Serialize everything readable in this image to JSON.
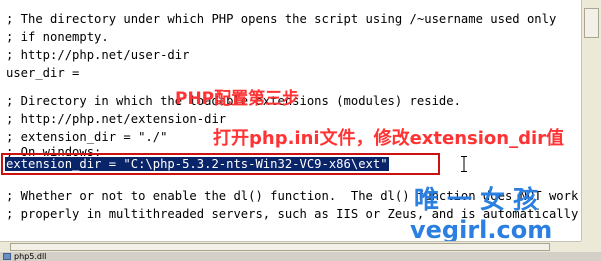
{
  "editor": {
    "lines": [
      "; The directory under which PHP opens the script using /~username used only",
      "; if nonempty.",
      "; http://php.net/user-dir",
      "user_dir =",
      "",
      "; Directory in which the loadable extensions (modules) reside.",
      "; http://php.net/extension-dir",
      "; extension_dir = \"./\"",
      "; On windows:",
      "extension_dir = \"C:\\php-5.3.2-nts-Win32-VC9-x86\\ext\"",
      "",
      "; Whether or not to enable the dl() function.  The dl() function does NOT work",
      "; properly in multithreaded servers, such as IIS or Zeus, and is automatically"
    ]
  },
  "annotations": {
    "step_title": "PHP配置第三步",
    "step_instruction": "打开php.ini文件，修改extension_dir值",
    "watermark_cn": "唯一女孩",
    "watermark_url": "vegirl.com"
  },
  "taskbar": {
    "item_label": "php5.dll"
  },
  "colors": {
    "selection_bg": "#0a246a",
    "highlight_box": "#cc1111",
    "annotation_red": "#ff3333",
    "watermark_blue": "#2b7fe0"
  }
}
